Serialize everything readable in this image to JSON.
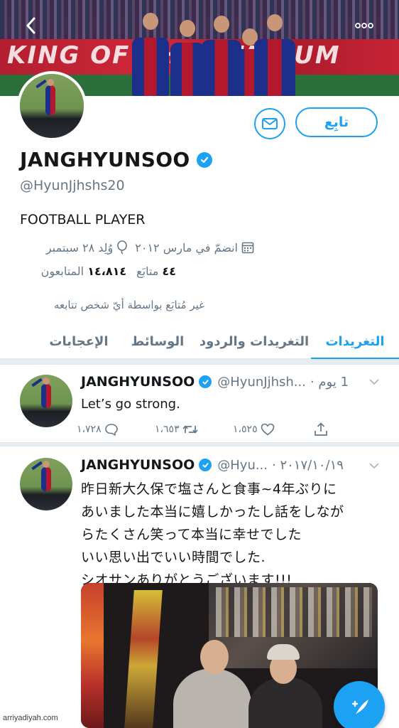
{
  "header": {
    "back_icon": "chevron-left-icon",
    "more_icon": "more-horizontal-icon",
    "banner_text": "KING OF THE STADIUM"
  },
  "profile": {
    "follow_label": "تابِع",
    "message_icon": "envelope-icon",
    "display_name": "JANGHYUNSOO",
    "handle": "@HyunJjhshs20",
    "bio": "FOOTBALL PLAYER",
    "joined": "انضمّ في مارس ٢٠١٢",
    "born": "وُلِد ٢٨ سبتمبر",
    "following_count": "٤٤",
    "following_label": "متابَع",
    "followers_count": "١٤،٨١٤",
    "followers_label": "المتابعون",
    "followers_note": "غير مُتابَع بواسطة أيّ شخص تتابعه"
  },
  "tabs": [
    {
      "label": "التغريدات",
      "active": true
    },
    {
      "label": "التغريدات والردود",
      "active": false
    },
    {
      "label": "الوسائط",
      "active": false
    },
    {
      "label": "الإعجابات",
      "active": false
    }
  ],
  "tweets": [
    {
      "name": "JANGHYUNSOO",
      "handle": "@HyunJjhsh...",
      "time": "1 يوم ·",
      "text": "Let’s go strong.",
      "replies": "١،٧٢٨",
      "retweets": "١،٦٥٣",
      "likes": "١،٥٢٥"
    },
    {
      "name": "JANGHYUNSOO",
      "handle": "@Hyu...",
      "time": "٢٠١٧/١٠/١٩ ·",
      "text_lines": [
        "昨日新大久保で塩さんと食事~4年ぶりに",
        "あいました本当に嬉しかったし話をしなが",
        "らたくさん笑って本当に幸せでした",
        "いい思い出でいい時間でした.",
        "シオサンありがとうございます!!!"
      ]
    }
  ],
  "watermark": "arriyadiyah.com",
  "colors": {
    "accent": "#1da1f2",
    "secondary_text": "#657786"
  }
}
